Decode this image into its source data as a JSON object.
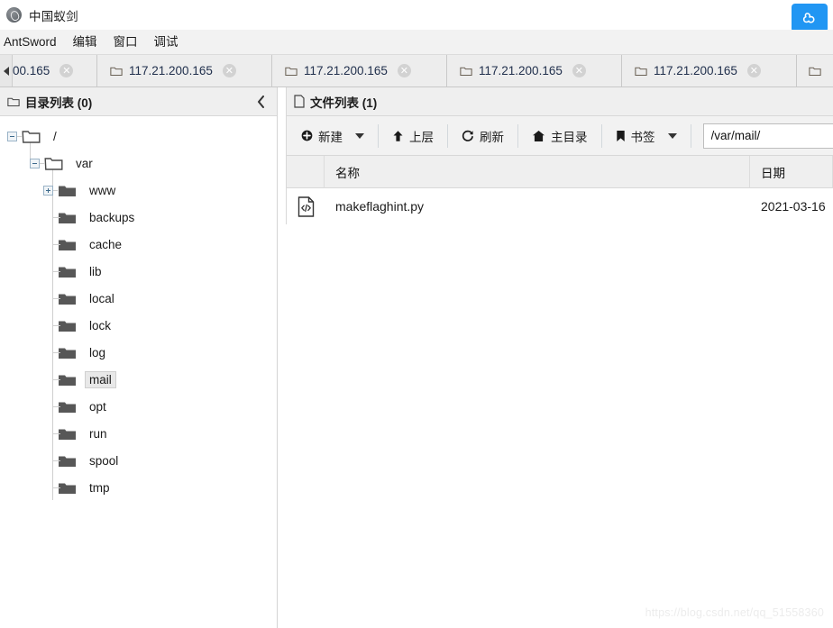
{
  "window": {
    "title": "中国蚁剑",
    "app_icon": "antsword-logo-icon",
    "badge_icon": "baidu-logo-icon",
    "badge_color": "#2196f3"
  },
  "menubar": {
    "items": [
      {
        "label": "AntSword"
      },
      {
        "label": "编辑"
      },
      {
        "label": "窗口"
      },
      {
        "label": "调试"
      }
    ]
  },
  "tabbar": {
    "scroll_left_icon": "chevron-left-icon",
    "tabs": [
      {
        "label": "00.165",
        "partial": true,
        "closable": true
      },
      {
        "label": "117.21.200.165",
        "partial": false,
        "closable": true
      },
      {
        "label": "117.21.200.165",
        "partial": false,
        "closable": true
      },
      {
        "label": "117.21.200.165",
        "partial": false,
        "closable": true
      },
      {
        "label": "117.21.200.165",
        "partial": false,
        "closable": true
      },
      {
        "label": "",
        "partial": false,
        "closable": false
      }
    ]
  },
  "left_panel": {
    "header": {
      "icon": "folder-icon",
      "title": "目录列表 (0)",
      "collapse_icon": "chevron-left-icon"
    },
    "tree": [
      {
        "label": "/",
        "depth": 0,
        "twist": "minus",
        "icon": "folder-open-outline-icon",
        "selected": false
      },
      {
        "label": "var",
        "depth": 1,
        "twist": "minus",
        "icon": "folder-open-outline-icon",
        "selected": false
      },
      {
        "label": "www",
        "depth": 2,
        "twist": "plus",
        "icon": "folder-solid-icon",
        "selected": false
      },
      {
        "label": "backups",
        "depth": 2,
        "twist": "none",
        "icon": "folder-solid-icon",
        "selected": false
      },
      {
        "label": "cache",
        "depth": 2,
        "twist": "none",
        "icon": "folder-solid-icon",
        "selected": false
      },
      {
        "label": "lib",
        "depth": 2,
        "twist": "none",
        "icon": "folder-solid-icon",
        "selected": false
      },
      {
        "label": "local",
        "depth": 2,
        "twist": "none",
        "icon": "folder-solid-icon",
        "selected": false
      },
      {
        "label": "lock",
        "depth": 2,
        "twist": "none",
        "icon": "folder-solid-icon",
        "selected": false
      },
      {
        "label": "log",
        "depth": 2,
        "twist": "none",
        "icon": "folder-solid-icon",
        "selected": false
      },
      {
        "label": "mail",
        "depth": 2,
        "twist": "none",
        "icon": "folder-solid-icon",
        "selected": true
      },
      {
        "label": "opt",
        "depth": 2,
        "twist": "none",
        "icon": "folder-solid-icon",
        "selected": false
      },
      {
        "label": "run",
        "depth": 2,
        "twist": "none",
        "icon": "folder-solid-icon",
        "selected": false
      },
      {
        "label": "spool",
        "depth": 2,
        "twist": "none",
        "icon": "folder-solid-icon",
        "selected": false
      },
      {
        "label": "tmp",
        "depth": 2,
        "twist": "none",
        "icon": "folder-solid-icon",
        "selected": false
      }
    ]
  },
  "right_panel": {
    "header": {
      "icon": "file-icon",
      "title": "文件列表 (1)"
    },
    "toolbar": {
      "new_label": "新建",
      "new_icon": "plus-circle-icon",
      "up_label": "上层",
      "up_icon": "arrow-up-icon",
      "refresh_label": "刷新",
      "refresh_icon": "refresh-icon",
      "home_label": "主目录",
      "home_icon": "home-icon",
      "bookmark_label": "书签",
      "bookmark_icon": "bookmark-icon",
      "path_value": "/var/mail/",
      "path_placeholder": "/"
    },
    "table": {
      "columns": {
        "name": "名称",
        "date": "日期"
      },
      "rows": [
        {
          "icon": "code-file-icon",
          "name": "makeflaghint.py",
          "date": "2021-03-16"
        }
      ]
    }
  },
  "watermark": {
    "text": "https://blog.csdn.net/qq_51558360"
  }
}
